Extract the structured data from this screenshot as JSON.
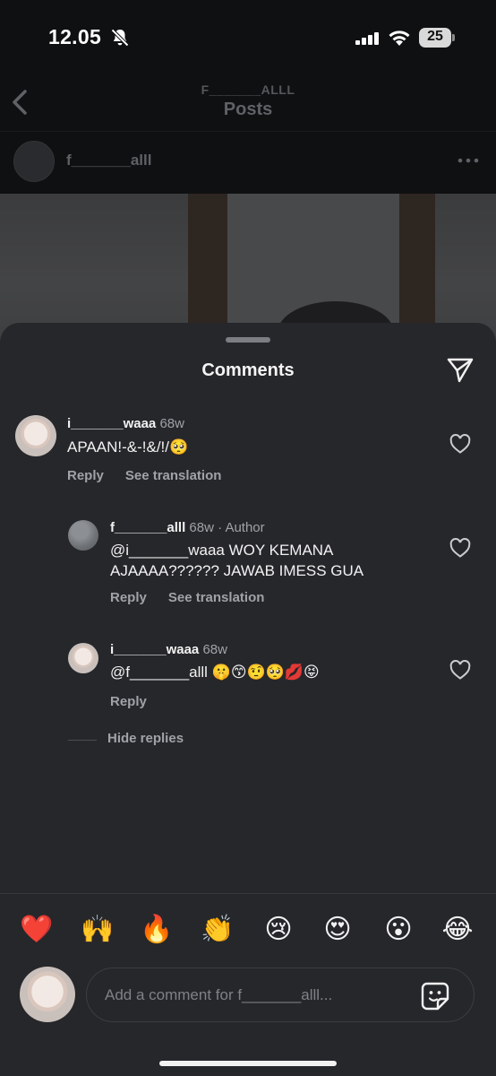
{
  "status_bar": {
    "time": "12.05",
    "battery": "25",
    "icons": [
      "bell-slash-icon",
      "cellular-signal-icon",
      "wifi-icon",
      "battery-icon"
    ]
  },
  "top_nav": {
    "username": "F_______ALLL",
    "title": "Posts",
    "back_icon": "chevron-left-icon"
  },
  "post": {
    "username": "f_______alll",
    "more_icon": "more-horizontal-icon"
  },
  "sheet": {
    "title": "Comments",
    "send_icon": "paper-plane-icon"
  },
  "comments": [
    {
      "user": "i_______waaa",
      "time": "68w",
      "text": "APAAN!-&-!&/!/🥺",
      "actions": [
        "Reply",
        "See translation"
      ]
    },
    {
      "user": "f_______alll",
      "time": "68w · Author",
      "text": "@i_______waaa WOY KEMANA AJAAAA?????? JAWAB IMESS GUA",
      "actions": [
        "Reply",
        "See translation"
      ]
    },
    {
      "user": "i_______waaa",
      "time": "68w",
      "text": "@f_______alll 🤫😙🤨🥺💋😝",
      "actions": [
        "Reply"
      ]
    }
  ],
  "hide_replies": "Hide replies",
  "reactions": [
    "❤️",
    "🙌",
    "🔥",
    "👏",
    "😢",
    "😍",
    "😮",
    "😂"
  ],
  "composer": {
    "placeholder": "Add a comment for f_______alll...",
    "sticker_icon": "sticker-icon"
  },
  "colors": {
    "sheet_bg": "#26272b",
    "background": "#0b0c0e",
    "secondary_text": "#a0a2a7",
    "heart_red": "#e0245e"
  }
}
